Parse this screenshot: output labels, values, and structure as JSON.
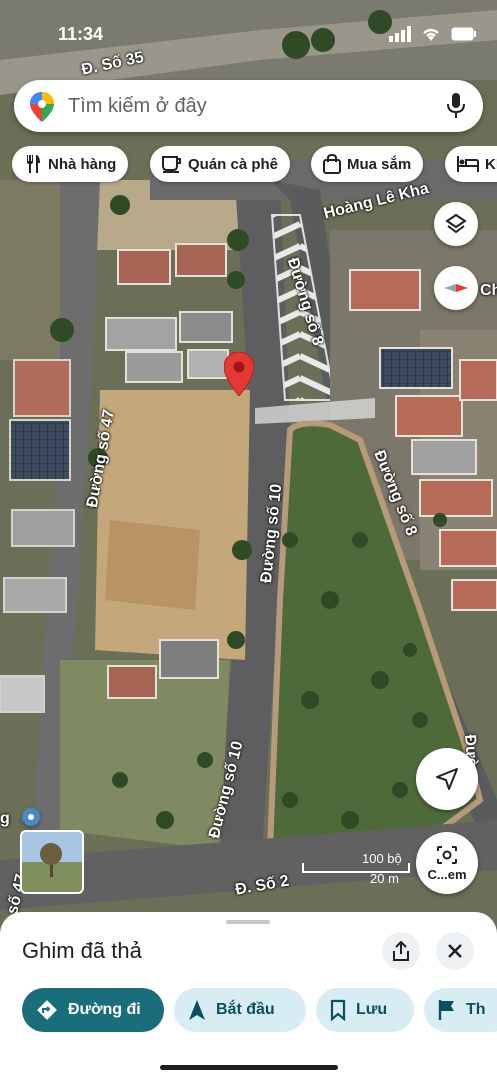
{
  "status_bar": {
    "time": "11:34"
  },
  "search": {
    "placeholder": "Tìm kiếm ở đây"
  },
  "chips": [
    {
      "label": "Nhà hàng",
      "icon": "fork-knife-icon"
    },
    {
      "label": "Quán cà phê",
      "icon": "coffee-cup-icon"
    },
    {
      "label": "Mua sắm",
      "icon": "shopping-bag-icon"
    },
    {
      "label": "Kh",
      "icon": "hotel-bed-icon"
    }
  ],
  "map": {
    "street_labels": {
      "so35": "Đ. Số 35",
      "hoang_le_kha": "Hoàng Lê Kha",
      "duong_so_8_upper": "Đường số 8",
      "duong_so_8_lower": "Đường số 8",
      "duong_so_47": "Đường số 47",
      "duong_so_10_upper": "Đường số 10",
      "duong_so_10_lower": "Đường số 10",
      "so2": "Đ. Số 2",
      "right_edge_partial": "Đườ",
      "left_edge_partial": "g",
      "left_edge_partial2": "số 47",
      "right_label_partial": "Ch"
    },
    "scale_bar": {
      "imperial": "100 bộ",
      "metric": "20 m"
    },
    "lens_label": "C...em",
    "colors": {
      "pin": "#e53935",
      "crosswalk": "#f2f2f2"
    }
  },
  "sheet": {
    "title": "Ghim đã thả",
    "actions": [
      {
        "label": "Đường đi",
        "icon": "directions-icon",
        "style": "primary"
      },
      {
        "label": "Bắt đầu",
        "icon": "navigation-arrow-icon",
        "style": "secondary"
      },
      {
        "label": "Lưu",
        "icon": "bookmark-icon",
        "style": "secondary"
      },
      {
        "label": "Th",
        "icon": "flag-icon",
        "style": "secondary"
      }
    ],
    "colors": {
      "primary": "#1a6e7b",
      "secondary": "#d7ecf3"
    }
  }
}
